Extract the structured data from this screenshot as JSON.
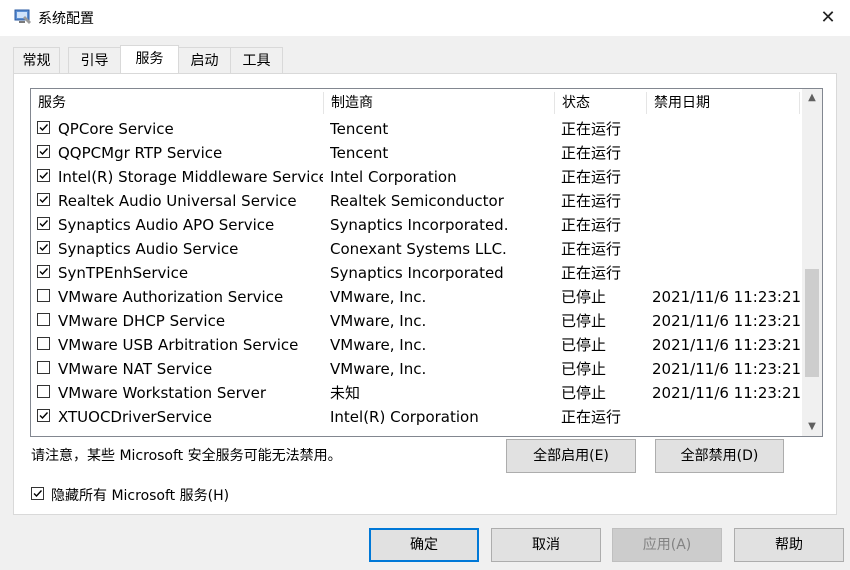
{
  "window": {
    "title": "系统配置",
    "close_icon": "close-icon"
  },
  "tabs": [
    {
      "label": "常规",
      "active": false
    },
    {
      "label": "引导",
      "active": false
    },
    {
      "label": "服务",
      "active": true
    },
    {
      "label": "启动",
      "active": false
    },
    {
      "label": "工具",
      "active": false
    }
  ],
  "table": {
    "headers": [
      "服务",
      "制造商",
      "状态",
      "禁用日期"
    ],
    "rows": [
      {
        "checked": true,
        "name": "QPCore Service",
        "vendor": "Tencent",
        "status": "正在运行",
        "date": ""
      },
      {
        "checked": true,
        "name": "QQPCMgr RTP Service",
        "vendor": "Tencent",
        "status": "正在运行",
        "date": ""
      },
      {
        "checked": true,
        "name": "Intel(R) Storage Middleware Service",
        "vendor": "Intel Corporation",
        "status": "正在运行",
        "date": ""
      },
      {
        "checked": true,
        "name": "Realtek Audio Universal Service",
        "vendor": "Realtek Semiconductor",
        "status": "正在运行",
        "date": ""
      },
      {
        "checked": true,
        "name": "Synaptics Audio APO Service",
        "vendor": "Synaptics Incorporated.",
        "status": "正在运行",
        "date": ""
      },
      {
        "checked": true,
        "name": "Synaptics Audio Service",
        "vendor": "Conexant Systems LLC.",
        "status": "正在运行",
        "date": ""
      },
      {
        "checked": true,
        "name": "SynTPEnhService",
        "vendor": "Synaptics Incorporated",
        "status": "正在运行",
        "date": ""
      },
      {
        "checked": false,
        "name": "VMware Authorization Service",
        "vendor": "VMware, Inc.",
        "status": "已停止",
        "date": "2021/11/6 11:23:21"
      },
      {
        "checked": false,
        "name": "VMware DHCP Service",
        "vendor": "VMware, Inc.",
        "status": "已停止",
        "date": "2021/11/6 11:23:21"
      },
      {
        "checked": false,
        "name": "VMware USB Arbitration Service",
        "vendor": "VMware, Inc.",
        "status": "已停止",
        "date": "2021/11/6 11:23:21"
      },
      {
        "checked": false,
        "name": "VMware NAT Service",
        "vendor": "VMware, Inc.",
        "status": "已停止",
        "date": "2021/11/6 11:23:21"
      },
      {
        "checked": false,
        "name": "VMware Workstation Server",
        "vendor": "未知",
        "status": "已停止",
        "date": "2021/11/6 11:23:21"
      },
      {
        "checked": true,
        "name": "XTUOCDriverService",
        "vendor": "Intel(R) Corporation",
        "status": "正在运行",
        "date": ""
      }
    ]
  },
  "scroll_position": 0.8,
  "notice": "请注意，某些 Microsoft 安全服务可能无法禁用。",
  "buttons": {
    "enable_all": "全部启用(E)",
    "disable_all": "全部禁用(D)",
    "ok": "确定",
    "cancel": "取消",
    "apply": "应用(A)",
    "help": "帮助"
  },
  "hide_ms": {
    "label": "隐藏所有 Microsoft 服务(H)",
    "checked": true
  }
}
